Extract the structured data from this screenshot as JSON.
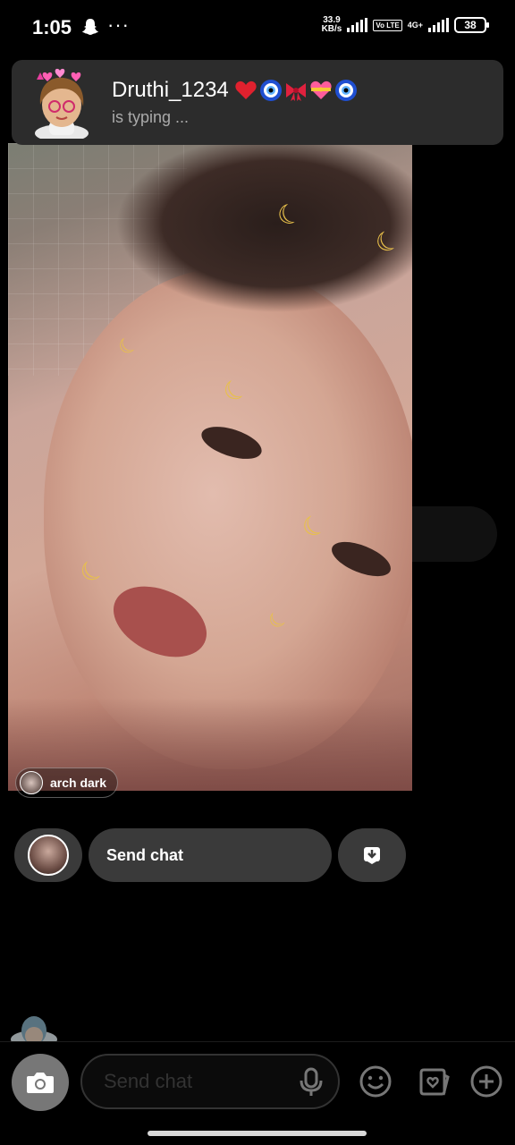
{
  "status_bar": {
    "time": "1:05",
    "net_speed_value": "33.9",
    "net_speed_unit": "KB/s",
    "network": "4G+",
    "volte": "Vo LTE",
    "battery": "38"
  },
  "notification": {
    "sender": "Druthi_1234",
    "emojis": [
      "red-heart",
      "nazar-amulet",
      "ribbon",
      "heart-with-ribbon",
      "nazar-amulet"
    ],
    "subtitle": "is typing ..."
  },
  "snap": {
    "sender_label": "arch dark"
  },
  "reply": {
    "placeholder": "Send chat"
  },
  "chat_bar": {
    "placeholder": "Send chat"
  },
  "colors": {
    "moon_sticker": "#e8c04a",
    "banner_bg": "#2c2c2c",
    "pill_bg": "#3a3a3a"
  }
}
